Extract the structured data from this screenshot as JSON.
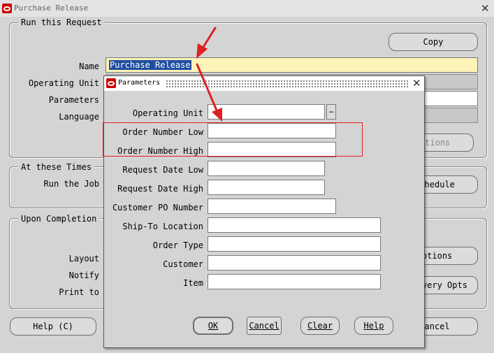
{
  "window": {
    "title": "Purchase Release"
  },
  "groups": {
    "run_request": "Run this Request",
    "at_times": "At these Times",
    "upon_completion": "Upon Completion"
  },
  "main": {
    "copy_label": "Copy",
    "name_label": "Name",
    "name_value": "Purchase Release",
    "operating_unit_label": "Operating Unit",
    "parameters_label": "Parameters",
    "language_label": "Language",
    "options_label": "Options",
    "run_job_label": "Run the Job",
    "schedule_label": "Schedule",
    "layout_label": "Layout",
    "notify_label": "Notify",
    "print_to_label": "Print to",
    "completion_options_label": "Options",
    "delivery_opts_label": "Delivery Opts",
    "help_label": "Help (C)",
    "cancel_label": "Cancel"
  },
  "dialog": {
    "title": "Parameters",
    "fields": {
      "operating_unit": {
        "label": "Operating Unit",
        "value": ""
      },
      "order_number_low": {
        "label": "Order Number Low",
        "value": ""
      },
      "order_number_high": {
        "label": "Order Number High",
        "value": ""
      },
      "request_date_low": {
        "label": "Request Date Low",
        "value": ""
      },
      "request_date_high": {
        "label": "Request Date High",
        "value": ""
      },
      "customer_po_number": {
        "label": "Customer PO Number",
        "value": ""
      },
      "ship_to_location": {
        "label": "Ship-To Location",
        "value": ""
      },
      "order_type": {
        "label": "Order Type",
        "value": ""
      },
      "customer": {
        "label": "Customer",
        "value": ""
      },
      "item": {
        "label": "Item",
        "value": ""
      }
    },
    "buttons": {
      "ok": "OK",
      "cancel": "Cancel",
      "clear": "Clear",
      "help": "Help"
    },
    "lov_glyph": "…"
  },
  "colors": {
    "highlight": "#e02020",
    "name_field": "#fff4b8",
    "oracle": "#cc0000"
  }
}
